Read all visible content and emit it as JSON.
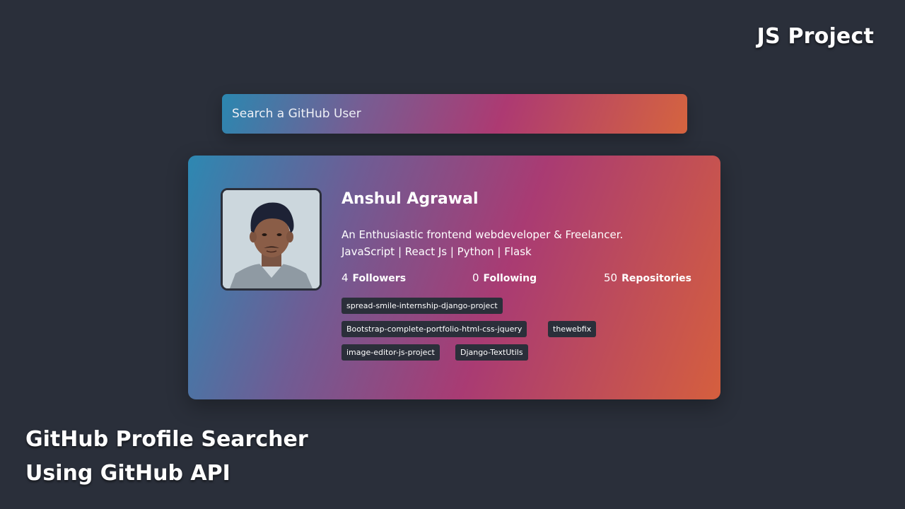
{
  "header": {
    "corner_title": "JS Project"
  },
  "caption": {
    "line1": "GitHub Profile Searcher",
    "line2": "Using GitHub API"
  },
  "search": {
    "placeholder": "Search a GitHub User",
    "value": ""
  },
  "profile": {
    "name": "Anshul Agrawal",
    "bio_line1": "An Enthusiastic frontend webdeveloper & Freelancer.",
    "bio_line2": "JavaScript | React Js | Python | Flask",
    "followers_count": "4",
    "followers_label": "Followers",
    "following_count": "0",
    "following_label": "Following",
    "repos_count": "50",
    "repos_label": "Repositories"
  },
  "repos": [
    "spread-smile-internship-django-project",
    "Bootstrap-complete-portfolio-html-css-jquery",
    "thewebfix",
    "image-editor-js-project",
    "Django-TextUtils"
  ],
  "colors": {
    "background": "#2a2f3a",
    "gradient_start": "#2d88b2",
    "gradient_mid": "#a93b73",
    "gradient_end": "#d55f3e",
    "tag_bg": "#2b2f3a"
  }
}
